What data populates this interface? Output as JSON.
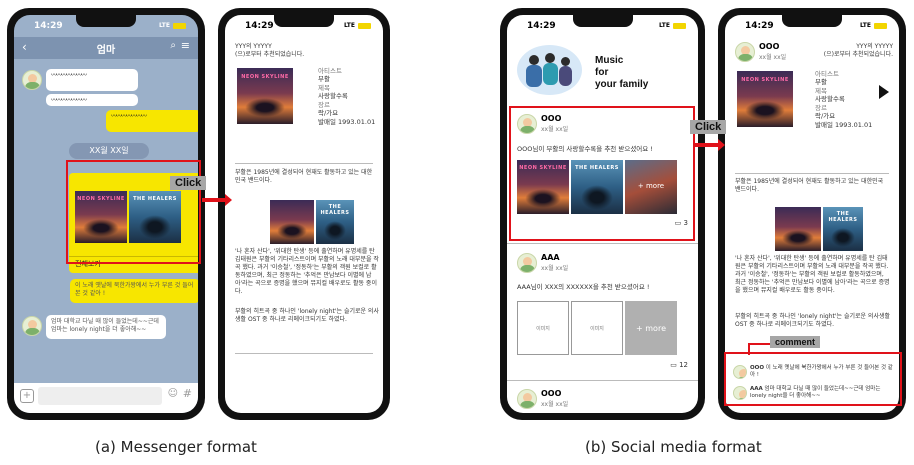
{
  "time": "14:29",
  "signal": "LTE",
  "captions": {
    "a": "(a) Messenger format",
    "b": "(b) Social media format"
  },
  "click": "Click",
  "comment_label": "comment",
  "messenger": {
    "title": "엄마",
    "wave": "〰〰〰〰〰〰〰",
    "date": "XX월 XX일",
    "view_all": "전체보기",
    "cover1": "NEON SKYLINE",
    "cover2": "THE HEALERS",
    "msg_yellow": "이 노래 옛날에 북한가왕에서 누가 부른 것 들어본 것 같아 !",
    "msg_reply": "엄마 대학교 다닐 때 많이 들었는데~~근데 엄마는 lonely night을 더 좋아해~~"
  },
  "detail": {
    "header1": "YYY의 YYYYY",
    "header2": "(으)로부터 추천되었습니다.",
    "artist_label": "아티스트",
    "artist": "부활",
    "title_label": "제목",
    "title": "사랑할수록",
    "genre_label": "장르",
    "genre": "락/가요",
    "release": "발매일 1993.01.01",
    "body1": "부활은 1985년에 결성되어 현재도 활동하고 있는 대한민국 밴드이다.",
    "body2": "'나 혼자 산다', '위대한 탄생' 등에 출연하며 유명세를 탄 김태원은 부활의 기타리스트이며 부활의 노래 대부분을 작곡 했다. 과거 '이승철', '정동하'는 부활의 객원 보컬로 활동하였으며, 최근 정동하는 '추억은 만남보다 이별에 남아'라는 곡으로 증명을 했으며 뮤지컬 배우로도 활동 중이다.",
    "body3": "부활의 히트곡 중 하나인 'lonely night'는 슬기로운 의사생활 OST 중 하나로 리메이크되기도 하였다."
  },
  "social": {
    "banner": [
      "Music",
      "for",
      "your family"
    ],
    "post1_user": "OOO",
    "post1_date": "xx월 xx일",
    "post1_text": "OOO님이 부활의 사랑할수록을 추천 받으셨어요 !",
    "more": "+ more",
    "post1_comments": "3",
    "post2_user": "AAA",
    "post2_date": "xx월 xx일",
    "post2_text": "AAA님이 XXX의 XXXXXX을 추천 받으셨어요 !",
    "ph": "이미지",
    "post2_comments": "12",
    "post3_user": "OOO",
    "post3_date": "xx월 xx일"
  },
  "social_detail": {
    "user": "OOO",
    "date": "xx월 xx일",
    "c1_user": "OOO",
    "c1_text": "이 노래 옛날에 북한가왕에서 누가 부른 것 들어본 것 같아 !",
    "c2_user": "AAA",
    "c2_text": "엄마 대학교 다닐 때 많이 들었는데~~근데 엄마는 lonely night을 더 좋아해~~"
  }
}
